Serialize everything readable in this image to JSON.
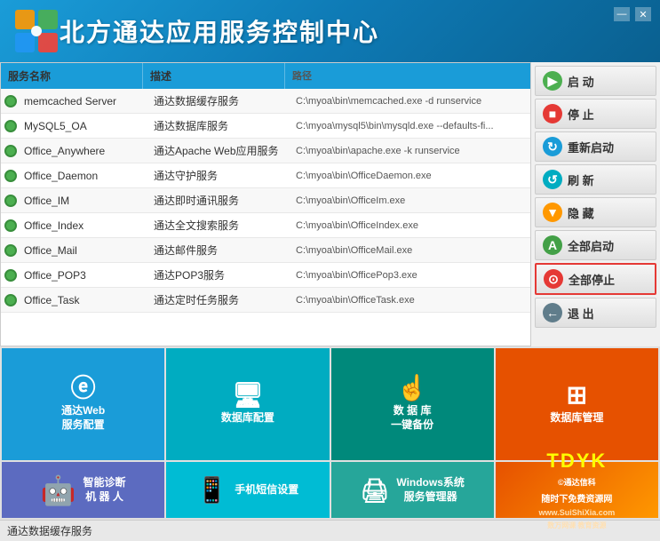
{
  "titleBar": {
    "title": "北方通达应用服务控制中心",
    "minBtn": "—",
    "closeBtn": "✕"
  },
  "tableHeader": {
    "col1": "服务名称",
    "col2": "描述",
    "col3": "路径"
  },
  "tableRows": [
    {
      "name": "memcached Server",
      "desc": "通达数据缓存服务",
      "path": "C:\\myoa\\bin\\memcached.exe -d runservice"
    },
    {
      "name": "MySQL5_OA",
      "desc": "通达数据库服务",
      "path": "C:\\myoa\\mysql5\\bin\\mysqld.exe --defaults-fi..."
    },
    {
      "name": "Office_Anywhere",
      "desc": "通达Apache Web应用服务",
      "path": "C:\\myoa\\bin\\apache.exe -k runservice"
    },
    {
      "name": "Office_Daemon",
      "desc": "通达守护服务",
      "path": "C:\\myoa\\bin\\OfficeDaemon.exe"
    },
    {
      "name": "Office_IM",
      "desc": "通达即时通讯服务",
      "path": "C:\\myoa\\bin\\OfficeIm.exe"
    },
    {
      "name": "Office_Index",
      "desc": "通达全文搜索服务",
      "path": "C:\\myoa\\bin\\OfficeIndex.exe"
    },
    {
      "name": "Office_Mail",
      "desc": "通达邮件服务",
      "path": "C:\\myoa\\bin\\OfficeMail.exe"
    },
    {
      "name": "Office_POP3",
      "desc": "通达POP3服务",
      "path": "C:\\myoa\\bin\\OfficePop3.exe"
    },
    {
      "name": "Office_Task",
      "desc": "通达定时任务服务",
      "path": "C:\\myoa\\bin\\OfficeTask.exe"
    }
  ],
  "rightButtons": [
    {
      "id": "start",
      "label": "启  动",
      "iconColor": "green",
      "icon": "▶",
      "danger": false
    },
    {
      "id": "stop",
      "label": "停  止",
      "iconColor": "red",
      "icon": "■",
      "danger": false
    },
    {
      "id": "restart",
      "label": "重新启动",
      "iconColor": "blue",
      "icon": "↻",
      "danger": false
    },
    {
      "id": "refresh",
      "label": "刷  新",
      "iconColor": "teal",
      "icon": "↺",
      "danger": false
    },
    {
      "id": "hide",
      "label": "隐  藏",
      "iconColor": "orange",
      "icon": "▼",
      "danger": false
    },
    {
      "id": "startall",
      "label": "全部启动",
      "iconColor": "green2",
      "icon": "A",
      "danger": false
    },
    {
      "id": "stopall",
      "label": "全部停止",
      "iconColor": "red2",
      "icon": "⊙",
      "danger": true
    },
    {
      "id": "exit",
      "label": "退  出",
      "iconColor": "gray",
      "icon": "←",
      "danger": false
    }
  ],
  "tiles": [
    {
      "id": "webconfig",
      "color": "blue",
      "icon": "ⓔ",
      "label": "通达Web\n服务配置"
    },
    {
      "id": "dbconfig",
      "color": "cyan",
      "icon": "🖥",
      "label": "数据库配置"
    },
    {
      "id": "dbbackup",
      "color": "teal",
      "icon": "👆",
      "label": "数 据 库\n一键备份"
    },
    {
      "id": "dbmanage",
      "color": "dbmanage",
      "icon": "⊞",
      "label": "数据库管理"
    },
    {
      "id": "robot",
      "color": "robot",
      "icon": "🤖",
      "label": "智能诊断\n机 器 人"
    },
    {
      "id": "sms",
      "color": "sms",
      "icon": "📱",
      "label": "手机短信设置"
    },
    {
      "id": "windows",
      "color": "windows",
      "icon": "🖨",
      "label": "Windows系统\n服务管理器"
    },
    {
      "id": "dbmanage2",
      "color": "dbmanage",
      "label": ""
    }
  ],
  "statusBar": {
    "text": "通达数据缓存服务"
  },
  "watermark": {
    "brand": "TDYK",
    "site": "www.SuiShiXia.com",
    "line1": "©通达信科",
    "line2": "随时下免费资源网",
    "line3": "数万网课 教育资源"
  }
}
